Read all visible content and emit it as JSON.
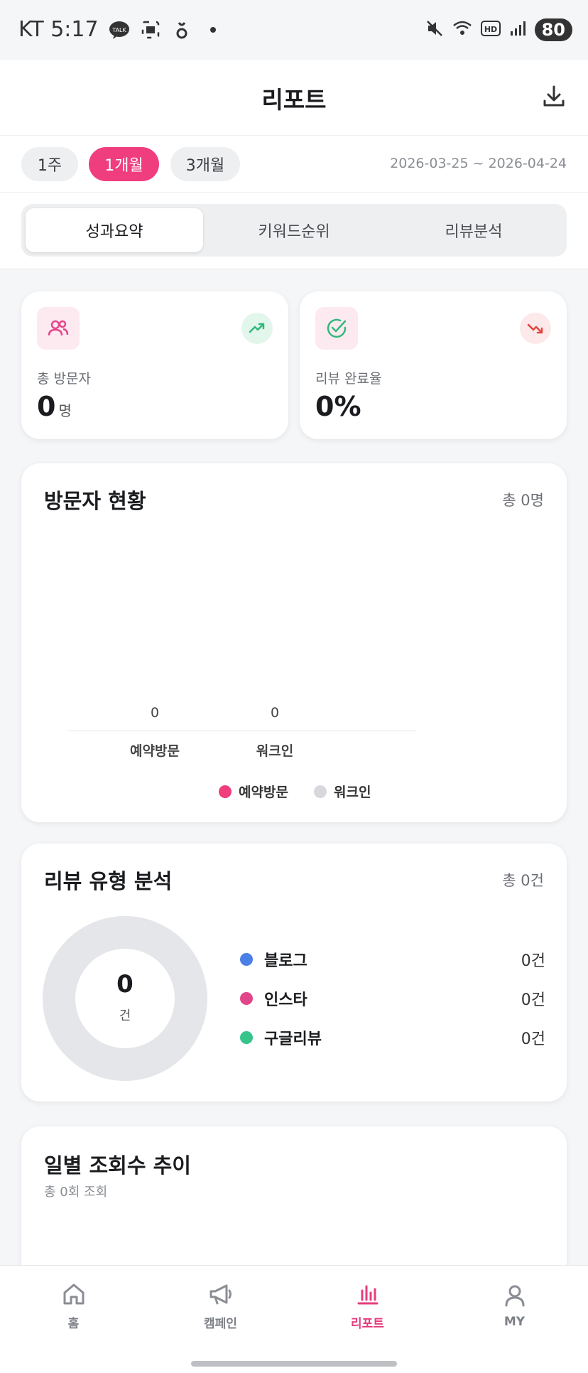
{
  "status_bar": {
    "carrier_time": "KT 5:17",
    "battery": "80"
  },
  "header": {
    "title": "리포트"
  },
  "period": {
    "options": [
      "1주",
      "1개월",
      "3개월"
    ],
    "selected": "1개월",
    "date_range": "2026-03-25 ~ 2026-04-24"
  },
  "tabs": [
    "성과요약",
    "키워드순위",
    "리뷰분석"
  ],
  "stats": {
    "visitors": {
      "label": "총 방문자",
      "value": "0",
      "unit": "명"
    },
    "review_rate": {
      "label": "리뷰 완료율",
      "value": "0%"
    }
  },
  "visitors_card": {
    "title": "방문자 현황",
    "total": "총 0명",
    "legend": [
      "예약방문",
      "워크인"
    ]
  },
  "chart_data": {
    "type": "bar",
    "categories": [
      "예약방문",
      "워크인"
    ],
    "values": [
      0,
      0
    ],
    "value_labels": [
      "0",
      "0"
    ],
    "colors": [
      "#ef3d7e",
      "#d6d8dc"
    ]
  },
  "review_card": {
    "title": "리뷰 유형 분석",
    "total": "총 0건",
    "center_value": "0",
    "center_unit": "건",
    "items": [
      {
        "name": "블로그",
        "value": "0건",
        "color": "#4a7fe8"
      },
      {
        "name": "인스타",
        "value": "0건",
        "color": "#e2468a"
      },
      {
        "name": "구글리뷰",
        "value": "0건",
        "color": "#35c48a"
      }
    ]
  },
  "daily_card": {
    "title": "일별 조회수 추이",
    "subtitle": "총 0회 조회"
  },
  "nav": [
    {
      "label": "홈",
      "icon": "home-icon"
    },
    {
      "label": "캠페인",
      "icon": "megaphone-icon"
    },
    {
      "label": "리포트",
      "icon": "bar-chart-icon"
    },
    {
      "label": "MY",
      "icon": "user-icon"
    }
  ],
  "colors": {
    "accent": "#ef3d7e",
    "green": "#2fb97a",
    "red": "#e0473e"
  }
}
